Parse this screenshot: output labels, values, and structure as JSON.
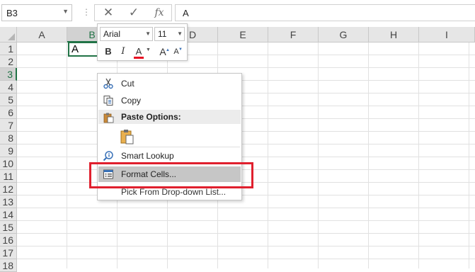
{
  "formula_bar": {
    "name_box": "B3",
    "name_box_dropdown_icon": "chevron-down-icon",
    "separator": "⋮",
    "cancel_icon": "✕",
    "enter_icon": "✓",
    "function_icon": "fx",
    "formula_value": "A"
  },
  "grid": {
    "columns": [
      "A",
      "B",
      "C",
      "D",
      "E",
      "F",
      "G",
      "H",
      "I"
    ],
    "rows": [
      "1",
      "2",
      "3",
      "4",
      "5",
      "6",
      "7",
      "8",
      "9",
      "10",
      "11",
      "12",
      "13",
      "14",
      "15",
      "16",
      "17",
      "18"
    ],
    "active_cell": {
      "ref": "B3",
      "value": "A"
    },
    "selected_column": "B",
    "selected_row": "3",
    "accent_color": "#217346"
  },
  "mini_toolbar": {
    "font_name": "Arial",
    "font_size": "11",
    "bold": "B",
    "italic": "I",
    "font_color": "A",
    "font_color_hex": "#e81123",
    "increase_font": "A",
    "decrease_font": "A"
  },
  "context_menu": {
    "cut": "Cut",
    "copy": "Copy",
    "paste_options": "Paste Options:",
    "smart_lookup": "Smart Lookup",
    "format_cells": "Format Cells...",
    "pick_from_list": "Pick From Drop-down List..."
  },
  "annotation": {
    "highlight_color": "#e0202e"
  }
}
